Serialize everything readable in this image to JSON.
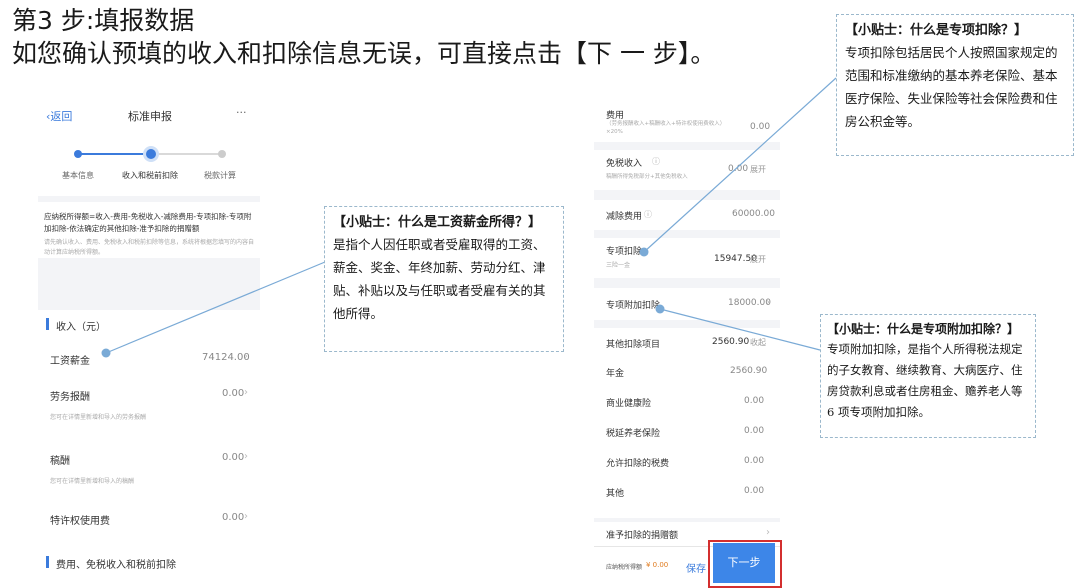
{
  "heading": {
    "step": "第3 步:填报数据",
    "description": "如您确认预填的收入和扣除信息无误，可直接点击【下 一 步】。"
  },
  "left_phone": {
    "back": "返回",
    "title": "标准申报",
    "more": "···",
    "steps": [
      "基本信息",
      "收入和税前扣除",
      "税款计算"
    ],
    "formula": "应纳税所得额=收入-费用-免税收入-减除费用-专项扣除-专项附加扣除-依法确定的其他扣除-准予扣除的捐赠额",
    "hint": "请先确认收入、费用、免税收入和税前扣除等信息，系统将根据您填写的内容自动计算应纳税所得额。",
    "income_section": "收入（元）",
    "rows": [
      {
        "label": "工资薪金",
        "value": "74124.00",
        "note": ""
      },
      {
        "label": "劳务报酬",
        "value": "0.00",
        "note": "您可在详情里新增和导入的劳务报酬"
      },
      {
        "label": "稿酬",
        "value": "0.00",
        "note": "您可在详情里新增和导入的稿酬"
      },
      {
        "label": "特许权使用费",
        "value": "0.00",
        "note": ""
      }
    ],
    "bottom_section": "费用、免税收入和税前扣除"
  },
  "right_phone": {
    "fee_label": "费用",
    "fee_note": "（劳务报酬收入+稿酬收入+特许权使用费收入）×20%",
    "fee_value": "0.00",
    "tax_free_label": "免税收入",
    "tax_free_note": "稿酬所得免税部分+其他免税收入",
    "tax_free_value": "0.00",
    "expand": "展开",
    "reduce_label": "减除费用",
    "reduce_value": "60000.00",
    "special_label": "专项扣除",
    "special_note": "三险一金",
    "special_value": "15947.50",
    "special_add_label": "专项附加扣除",
    "special_add_value": "18000.00",
    "other_label": "其他扣除项目",
    "other_value": "2560.90",
    "collapse": "收起",
    "other_items": [
      {
        "label": "年金",
        "value": "2560.90"
      },
      {
        "label": "商业健康险",
        "value": "0.00"
      },
      {
        "label": "税延养老保险",
        "value": "0.00"
      },
      {
        "label": "允许扣除的税费",
        "value": "0.00"
      },
      {
        "label": "其他",
        "value": "0.00"
      }
    ],
    "donation_label": "准予扣除的捐赠额",
    "taxable_label": "应纳税所得额",
    "taxable_value": "¥ 0.00",
    "save": "保存",
    "next": "下一步"
  },
  "tips": {
    "salary": {
      "title": "【小贴士：什么是工资薪金所得？】",
      "body": "是指个人因任职或者受雇取得的工资、薪金、奖金、年终加薪、劳动分红、津贴、补贴以及与任职或者受雇有关的其他所得。"
    },
    "special": {
      "title": "【小贴士：什么是专项扣除？】",
      "body": "专项扣除包括居民个人按照国家规定的范围和标准缴纳的基本养老保险、基本医疗保险、失业保险等社会保险费和住房公积金等。"
    },
    "special_add": {
      "title": "【小贴士：什么是专项附加扣除？】",
      "body": "专项附加扣除，是指个人所得税法规定的子女教育、继续教育、大病医疗、住房贷款利息或者住房租金、赡养老人等6 项专项附加扣除。"
    }
  },
  "colors": {
    "accent": "#3d86e8",
    "highlight_box": "#d32f2f",
    "tip_border": "#9bb8cc"
  }
}
